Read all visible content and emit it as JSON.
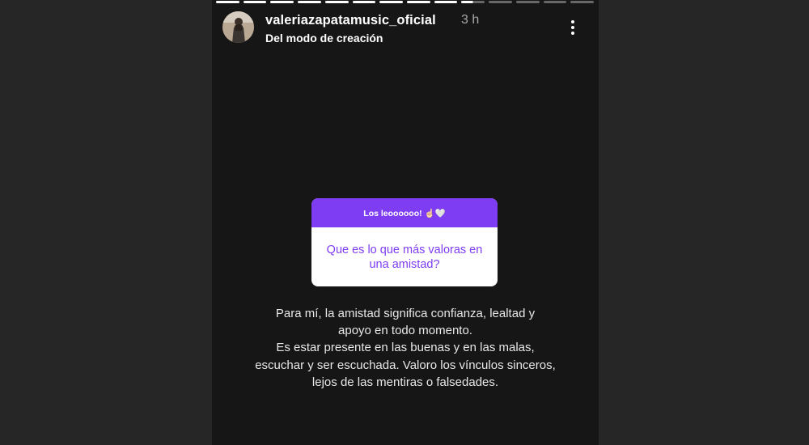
{
  "story": {
    "progress": {
      "segments": 14,
      "completed": 9,
      "active_fraction": 0.5
    },
    "header": {
      "username": "valeriazapatamusic_oficial",
      "time": "3 h",
      "subtitle": "Del modo de creación",
      "avatar_icon": "profile-photo",
      "more_icon": "more-vertical-icon"
    },
    "question_sticker": {
      "prompt": "Los leoooooo! ☝🏻🤍",
      "question": "Que es lo que más valoras en una amistad?",
      "accent_color": "#7e3cf3"
    },
    "caption": {
      "lines": [
        "Para mí, la amistad significa confianza, lealtad y",
        "apoyo en todo momento.",
        "Es estar presente en las buenas y en las malas,",
        "escuchar y ser escuchada. Valoro los vínculos sinceros,",
        "lejos de las mentiras o falsedades."
      ]
    }
  }
}
